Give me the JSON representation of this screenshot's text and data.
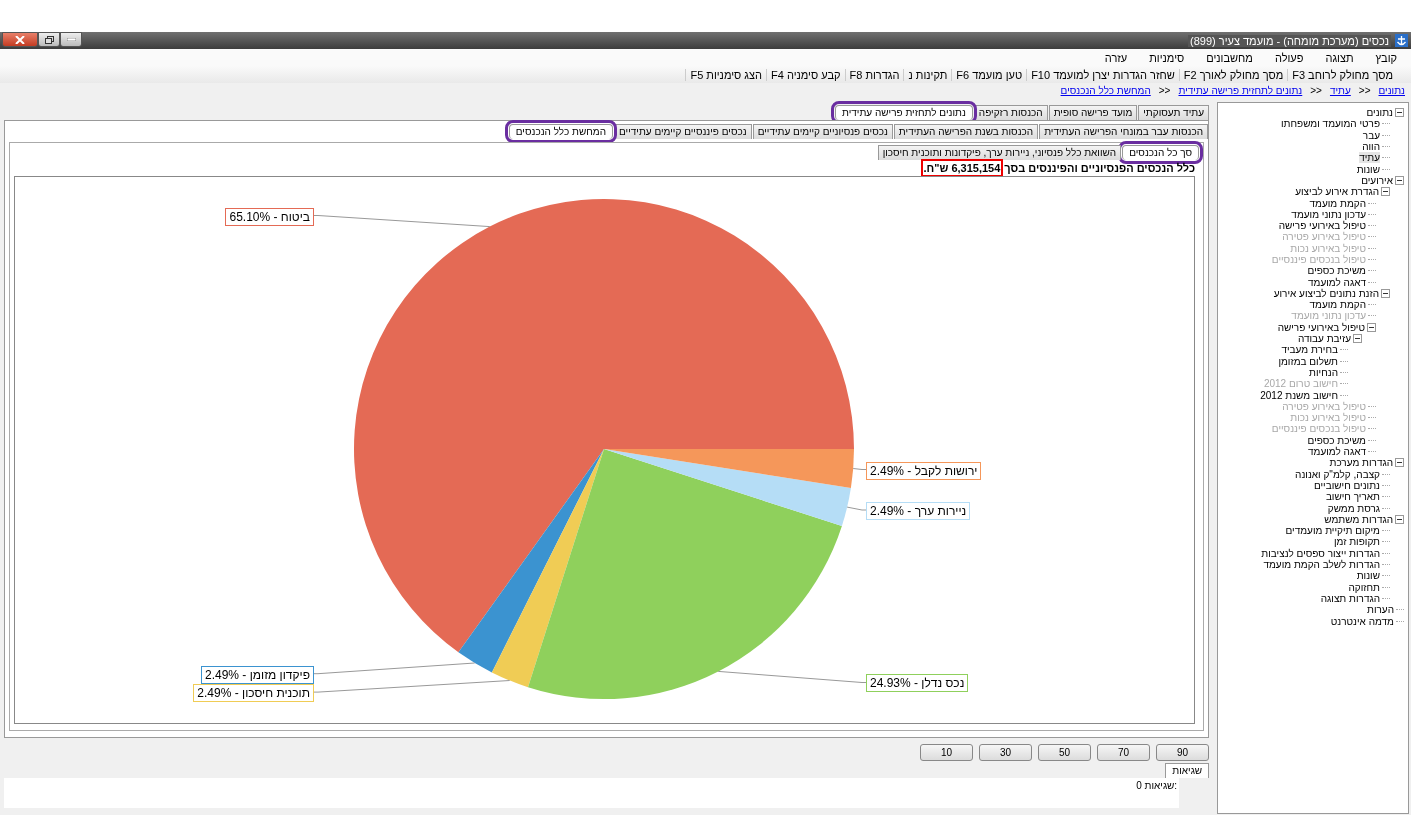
{
  "window": {
    "title": "נכסים (מערכת מומחה) - מועמד צעיר (899)"
  },
  "menu": [
    "קובץ",
    "תצוגה",
    "פעולה",
    "מחשבונים",
    "סימניות",
    "עזרה"
  ],
  "toolbar": [
    "מסך מחולק לרוחב F3",
    "מסך מחולק לאורך F2",
    "שחזר הגדרות יצרן למועמד F10",
    "טען מועמד F6",
    "תקינות נ",
    "הגדרות F8",
    "קבע סימניה F4",
    "הצג סימניות F5"
  ],
  "breadcrumb": [
    "נתונים",
    "עתיד",
    "נתונים לתחזית פרישה עתידית",
    "המחשת כלל הנכנסים"
  ],
  "breadcrumb_separator": ">>",
  "tabs_row_1": [
    {
      "label": "עתיד תעסוקתי",
      "selected": false,
      "highlighted": false
    },
    {
      "label": "מועד פרישה סופית",
      "selected": false,
      "highlighted": false
    },
    {
      "label": "הכנסות רזקיפה",
      "selected": false,
      "highlighted": false
    },
    {
      "label": "נתונים לתחזית פרישה עתידית",
      "selected": true,
      "highlighted": true
    }
  ],
  "tabs_row_2": [
    {
      "label": "הכנסות עבר במונחי הפרישה העתידית",
      "selected": false,
      "highlighted": false
    },
    {
      "label": "הכנסות בשנת הפרישה העתידית",
      "selected": false,
      "highlighted": false
    },
    {
      "label": "נכסים פנסיוניים קיימים עתידיים",
      "selected": false,
      "highlighted": false
    },
    {
      "label": "נכסים פיננסיים קיימים עתידיים",
      "selected": false,
      "highlighted": false
    },
    {
      "label": "המחשת כלל הנכנסים",
      "selected": true,
      "highlighted": true
    }
  ],
  "tabs_row_3": [
    {
      "label": "סך כל הנכנסים",
      "selected": true,
      "highlighted": true
    },
    {
      "label": "השוואת כלל פנסיוני, ניירות ערך, פיקדונות ותוכנית חיסכון",
      "selected": false,
      "highlighted": false
    }
  ],
  "summary": {
    "text": "כלל הנכסים הפנסיוניים והפיננסים בסך",
    "amount": "6,315,154 ש\"ח.",
    "amount_highlighted": true
  },
  "chart_data": {
    "type": "pie",
    "categories": [
      "ביטוח - 65.10%",
      "פיקדון מזומן - 2.49%",
      "תוכנית חיסכון - 2.49%",
      "נכס נדלן - 24.93%",
      "ניירות ערך - 2.49%",
      "ירושות לקבל - 2.49%"
    ],
    "series": [
      {
        "values": [
          65.1,
          2.49,
          2.49,
          24.93,
          2.49,
          2.49
        ]
      }
    ],
    "colors": [
      "#e46a55",
      "#3b93d0",
      "#f0cc55",
      "#8fd05c",
      "#b5ddf6",
      "#f5975a"
    ]
  },
  "level_buttons": [
    "90",
    "70",
    "50",
    "30",
    "10"
  ],
  "errors": {
    "tab": "שגיאות",
    "text": "0 שגיאות:"
  },
  "tree": [
    {
      "label": "נתונים",
      "expanded": true,
      "selected": false,
      "disabled": false,
      "children": [
        {
          "label": "פרטי המועמד ומשפחתו",
          "selected": false,
          "disabled": false
        },
        {
          "label": "עבר",
          "selected": false,
          "disabled": false
        },
        {
          "label": "הווה",
          "selected": false,
          "disabled": false
        },
        {
          "label": "עתיד",
          "selected": true,
          "disabled": false
        },
        {
          "label": "שונות",
          "selected": false,
          "disabled": false
        }
      ]
    },
    {
      "label": "אירועים",
      "expanded": true,
      "selected": false,
      "disabled": false,
      "children": [
        {
          "label": "הגדרת אירוע לביצוע",
          "expanded": true,
          "selected": false,
          "disabled": false,
          "children": [
            {
              "label": "הקמת מועמד",
              "selected": false,
              "disabled": false
            },
            {
              "label": "עדכון נתוני מועמד",
              "selected": false,
              "disabled": false
            },
            {
              "label": "טיפול באירועי פרישה",
              "selected": false,
              "disabled": false
            },
            {
              "label": "טיפול באירוע פטירה",
              "selected": false,
              "disabled": true
            },
            {
              "label": "טיפול באירוע נכות",
              "selected": false,
              "disabled": true
            },
            {
              "label": "טיפול בנכסים פיננסיים",
              "selected": false,
              "disabled": true
            },
            {
              "label": "משיכת כספים",
              "selected": false,
              "disabled": false
            },
            {
              "label": "דאגה למועמד",
              "selected": false,
              "disabled": false
            }
          ]
        },
        {
          "label": "הזנת נתונים לביצוע אירוע",
          "expanded": true,
          "selected": false,
          "disabled": false,
          "children": [
            {
              "label": "הקמת מועמד",
              "selected": false,
              "disabled": false
            },
            {
              "label": "עדכון נתוני מועמד",
              "selected": false,
              "disabled": true
            },
            {
              "label": "טיפול באירועי פרישה",
              "expanded": true,
              "selected": false,
              "disabled": false,
              "children": [
                {
                  "label": "עזיבת עבודה",
                  "expanded": true,
                  "selected": false,
                  "disabled": false,
                  "children": [
                    {
                      "label": "בחירת מעביד",
                      "selected": false,
                      "disabled": false
                    },
                    {
                      "label": "תשלום במזומן",
                      "selected": false,
                      "disabled": false
                    },
                    {
                      "label": "הנחיות",
                      "selected": false,
                      "disabled": false
                    },
                    {
                      "label": "חישוב טרום 2012",
                      "selected": false,
                      "disabled": true
                    },
                    {
                      "label": "חישוב משנת 2012",
                      "selected": false,
                      "disabled": false
                    }
                  ]
                }
              ]
            },
            {
              "label": "טיפול באירוע פטירה",
              "selected": false,
              "disabled": true
            },
            {
              "label": "טיפול באירוע נכות",
              "selected": false,
              "disabled": true
            },
            {
              "label": "טיפול בנכסים פיננסיים",
              "selected": false,
              "disabled": true
            },
            {
              "label": "משיכת כספים",
              "selected": false,
              "disabled": false
            },
            {
              "label": "דאגה למועמד",
              "selected": false,
              "disabled": false
            }
          ]
        }
      ]
    },
    {
      "label": "הגדרות מערכת",
      "expanded": true,
      "selected": false,
      "disabled": false,
      "children": [
        {
          "label": "קצבה, קלמ\"ק ואנונה",
          "selected": false,
          "disabled": false
        },
        {
          "label": "נתונים חישוביים",
          "selected": false,
          "disabled": false
        },
        {
          "label": "תאריך חישוב",
          "selected": false,
          "disabled": false
        },
        {
          "label": "גרסת ממשק",
          "selected": false,
          "disabled": false
        }
      ]
    },
    {
      "label": "הגדרות משתמש",
      "expanded": true,
      "selected": false,
      "disabled": false,
      "children": [
        {
          "label": "מיקום תיקיית מועמדים",
          "selected": false,
          "disabled": false
        },
        {
          "label": "תקופות זמן",
          "selected": false,
          "disabled": false
        },
        {
          "label": "הגדרות ייצור ספסים לנציבות",
          "selected": false,
          "disabled": false
        },
        {
          "label": "הגדרות לשלב הקמת מועמד",
          "selected": false,
          "disabled": false
        },
        {
          "label": "שונות",
          "selected": false,
          "disabled": false
        },
        {
          "label": "תחזוקה",
          "selected": false,
          "disabled": false
        },
        {
          "label": "הגדרות תצוגה",
          "selected": false,
          "disabled": false
        }
      ]
    },
    {
      "label": "הערות",
      "selected": false,
      "disabled": false
    },
    {
      "label": "מדמה אינטרנט",
      "selected": false,
      "disabled": false
    }
  ]
}
